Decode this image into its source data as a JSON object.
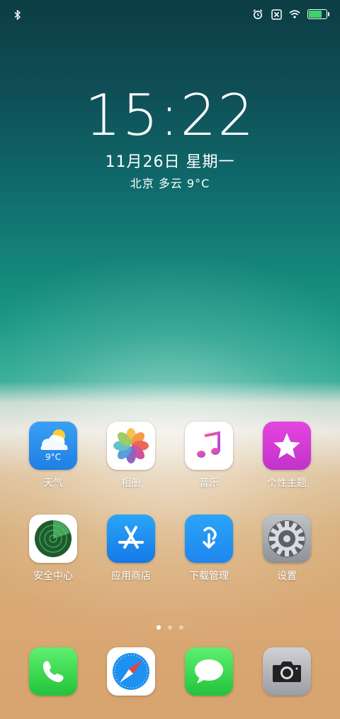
{
  "status_bar": {
    "left_icon": "bluetooth-icon",
    "right_icons": [
      "alarm-icon",
      "sim-off-icon",
      "wifi-icon",
      "battery-charging-icon"
    ],
    "battery_level": 0.8
  },
  "lockscreen": {
    "time": "15:22",
    "date": "11月26日  星期一",
    "weather": "北京  多云  9°C"
  },
  "apps": [
    {
      "label": "天气",
      "icon": "weather-icon",
      "icon_text": "9°C"
    },
    {
      "label": "相册",
      "icon": "photos-icon"
    },
    {
      "label": "音乐",
      "icon": "music-icon"
    },
    {
      "label": "个性主题",
      "icon": "themes-icon"
    },
    {
      "label": "安全中心",
      "icon": "security-radar-icon"
    },
    {
      "label": "应用商店",
      "icon": "app-store-icon"
    },
    {
      "label": "下载管理",
      "icon": "download-icon"
    },
    {
      "label": "设置",
      "icon": "settings-gear-icon"
    }
  ],
  "page_indicator": {
    "pages": 3,
    "current": 1
  },
  "dock": [
    {
      "icon": "phone-icon"
    },
    {
      "icon": "safari-compass-icon"
    },
    {
      "icon": "messages-icon"
    },
    {
      "icon": "camera-icon"
    }
  ],
  "colors": {
    "accent_green": "#3cd36c",
    "weather_blue": "#2e8ff0",
    "themes_pink": "#d63ad9",
    "appstore_blue": "#1d8ff2"
  }
}
